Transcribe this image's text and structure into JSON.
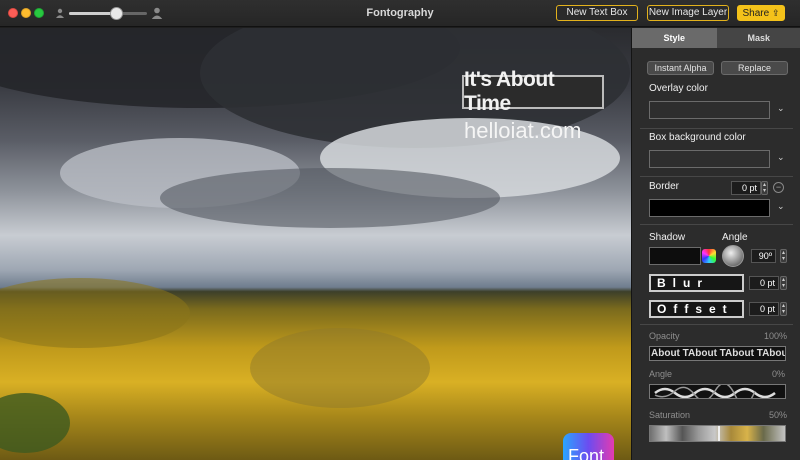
{
  "titlebar": {
    "app_title": "Fontography",
    "new_text_box": "New Text Box",
    "new_image_layer": "New Image Layer",
    "share": "Share",
    "zoom_level": 0.6
  },
  "canvas": {
    "watermark_text": "It's About Time",
    "watermark_url": "helloiat.com",
    "app_badge_text": "Font"
  },
  "panel": {
    "tabs": [
      "Style",
      "Mask"
    ],
    "active_tab": "Style",
    "instant_alpha": "Instant Alpha",
    "replace": "Replace",
    "overlay_color_label": "Overlay color",
    "box_bg_label": "Box background color",
    "border_label": "Border",
    "border_value": "0 pt",
    "border_color": "#000000",
    "shadow_label": "Shadow",
    "angle_label": "Angle",
    "shadow_angle_value": "90º",
    "blur_text": "Blur",
    "blur_value": "0 pt",
    "offset_text": "Offset",
    "offset_value": "0 pt",
    "opacity_label": "Opacity",
    "opacity_value": "100%",
    "opacity_preview": "About TAbout TAbout TAbout T",
    "angle_slider_label": "Angle",
    "angle_slider_value": "0%",
    "saturation_label": "Saturation",
    "saturation_value": "50%"
  },
  "colors": {
    "accent": "#f4c21a",
    "panel_bg": "#2c2c2c"
  }
}
